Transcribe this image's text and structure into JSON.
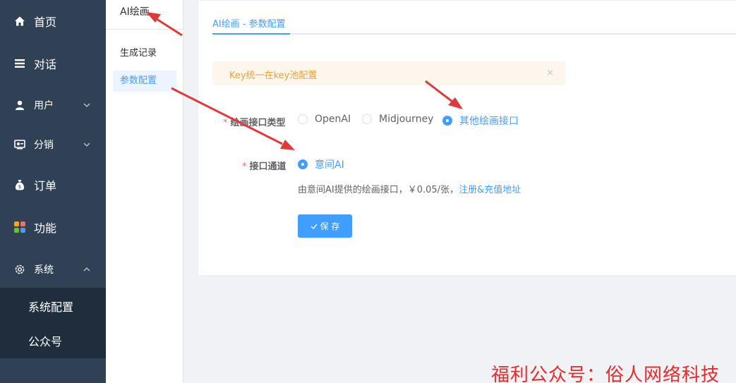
{
  "sidebar": {
    "items": [
      {
        "label": "首页",
        "icon": "home-icon"
      },
      {
        "label": "对话",
        "icon": "list-icon"
      },
      {
        "label": "用户",
        "icon": "user-icon"
      },
      {
        "label": "分销",
        "icon": "distribution-icon"
      },
      {
        "label": "订单",
        "icon": "money-bag-icon"
      },
      {
        "label": "功能",
        "icon": "grid-icon"
      },
      {
        "label": "系统",
        "icon": "gear-icon"
      }
    ],
    "system_submenu": [
      {
        "label": "系统配置"
      },
      {
        "label": "公众号"
      }
    ]
  },
  "subnav": {
    "title": "AI绘画",
    "items": [
      {
        "label": "生成记录"
      },
      {
        "label": "参数配置"
      }
    ]
  },
  "main": {
    "tab_label": "AI绘画 - 参数配置",
    "alert": {
      "text": "Key统一在key池配置",
      "close": "×"
    },
    "form": {
      "type_label": "绘画接口类型",
      "type_options": [
        "OpenAI",
        "Midjourney",
        "其他绘画接口"
      ],
      "type_selected": "其他绘画接口",
      "channel_label": "接口通道",
      "channel_options": [
        "意间AI"
      ],
      "channel_selected": "意间AI",
      "desc_text": "由意间AI提供的绘画接口，￥0.05/张，",
      "desc_link": "注册&充值地址",
      "save_label": "保 存",
      "required_mark": "*"
    }
  },
  "watermark": "福利公众号：俗人网络科技",
  "colors": {
    "sidebar_bg": "#304156",
    "submenu_bg": "#1f2d3d",
    "primary": "#409eff",
    "warning": "#e6a23c",
    "annotation_arrow": "#e03a3a"
  }
}
